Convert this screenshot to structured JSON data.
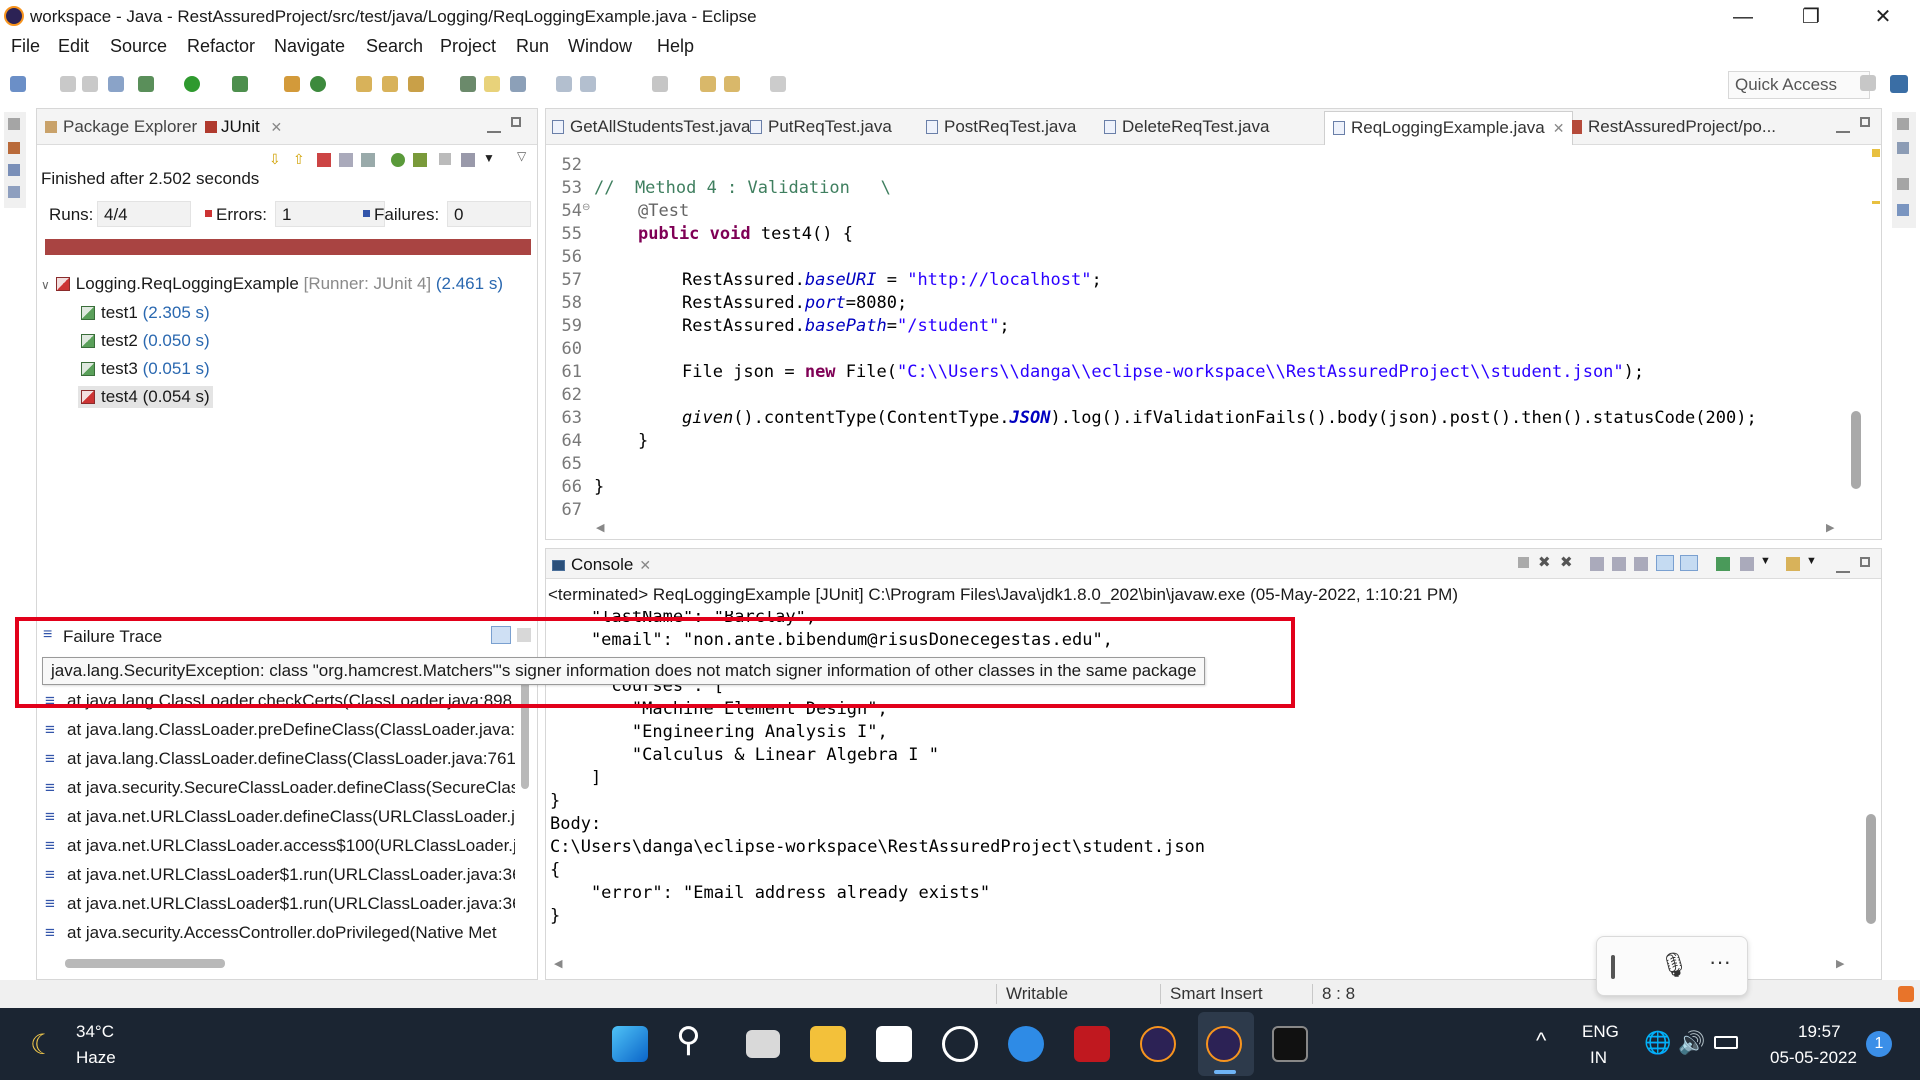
{
  "window": {
    "title": "workspace - Java - RestAssuredProject/src/test/java/Logging/ReqLoggingExample.java - Eclipse"
  },
  "menu": [
    "File",
    "Edit",
    "Source",
    "Refactor",
    "Navigate",
    "Search",
    "Project",
    "Run",
    "Window",
    "Help"
  ],
  "quick_access": "Quick Access",
  "left_view": {
    "tabs": [
      "Package Explorer",
      "JUnit"
    ],
    "status": "Finished after 2.502 seconds",
    "runs_label": "Runs:",
    "runs_value": "4/4",
    "errors_label": "Errors:",
    "errors_value": "1",
    "failures_label": "Failures:",
    "failures_value": "0",
    "suite": {
      "name": "Logging.ReqLoggingExample",
      "runner": "[Runner: JUnit 4]",
      "time": "(2.461 s)"
    },
    "tests": [
      {
        "name": "test1",
        "time": "(2.305 s)"
      },
      {
        "name": "test2",
        "time": "(0.050 s)"
      },
      {
        "name": "test3",
        "time": "(0.051 s)"
      },
      {
        "name": "test4",
        "time": "(0.054 s)"
      }
    ],
    "failure_trace_title": "Failure Trace",
    "trace": [
      "at java.lang.ClassLoader.checkCerts(ClassLoader.java:898",
      "at java.lang.ClassLoader.preDefineClass(ClassLoader.java:",
      "at java.lang.ClassLoader.defineClass(ClassLoader.java:761",
      "at java.security.SecureClassLoader.defineClass(SecureClas",
      "at java.net.URLClassLoader.defineClass(URLClassLoader.ja",
      "at java.net.URLClassLoader.access$100(URLClassLoader.ja",
      "at java.net.URLClassLoader$1.run(URLClassLoader.java:36",
      "at java.net.URLClassLoader$1.run(URLClassLoader.java:36",
      "at java.security.AccessController.doPrivileged(Native Met"
    ]
  },
  "tooltip": "java.lang.SecurityException: class \"org.hamcrest.Matchers\"'s signer information does not match signer information of other classes in the same package",
  "editor": {
    "tabs": [
      "GetAllStudentsTest.java",
      "PutReqTest.java",
      "PostReqTest.java",
      "DeleteReqTest.java",
      "ReqLoggingExample.java",
      "RestAssuredProject/po..."
    ],
    "line_numbers": [
      "52",
      "53",
      "54",
      "55",
      "56",
      "57",
      "58",
      "59",
      "60",
      "61",
      "62",
      "63",
      "64",
      "65",
      "66",
      "67"
    ],
    "code": {
      "l53": "//  Method 4 : Validation   \\",
      "l54": "@Test",
      "l55_kw": "public void",
      "l55_rest": " test4() {",
      "l57_a": "RestAssured.",
      "l57_f": "baseURI",
      "l57_b": " = ",
      "l57_s": "\"http://localhost\"",
      "l57_c": ";",
      "l58_a": "RestAssured.",
      "l58_f": "port",
      "l58_b": "=8080;",
      "l59_a": "RestAssured.",
      "l59_f": "basePath",
      "l59_b": "=",
      "l59_s": "\"/student\"",
      "l59_c": ";",
      "l61_a": "File json = ",
      "l61_kw": "new",
      "l61_b": " File(",
      "l61_s": "\"C:\\\\Users\\\\danga\\\\eclipse-workspace\\\\RestAssuredProject\\\\student.json\"",
      "l61_c": ");",
      "l63_a": "given",
      "l63_b": "().contentType(ContentType.",
      "l63_f": "JSON",
      "l63_c": ").log().ifValidationFails().body(json).post().then().statusCode(200);",
      "l64": "}",
      "l66": "}"
    }
  },
  "console": {
    "tab": "Console",
    "header": "<terminated> ReqLoggingExample [JUnit] C:\\Program Files\\Java\\jdk1.8.0_202\\bin\\javaw.exe (05-May-2022, 1:10:21 PM)",
    "lines": [
      "    \"lastName\": \"Barclay\",",
      "    \"email\": \"non.ante.bibendum@risusDonecegestas.edu\",",
      "     ",
      "     \"courses\": [",
      "        \"Machine Element Design\",",
      "        \"Engineering Analysis I\",",
      "        \"Calculus & Linear Algebra I \"",
      "    ]",
      "}",
      "Body:",
      "C:\\Users\\danga\\eclipse-workspace\\RestAssuredProject\\student.json",
      "{",
      "    \"error\": \"Email address already exists\"",
      "}"
    ]
  },
  "statusbar": {
    "writable": "Writable",
    "insert_mode": "Smart Insert",
    "position": "8 : 8"
  },
  "taskbar": {
    "weather_temp": "34°C",
    "weather_desc": "Haze",
    "lang": "ENG",
    "region": "IN",
    "time": "19:57",
    "date": "05-05-2022",
    "notifications": "1"
  },
  "colors": {
    "error_bar": "#a94442",
    "highlight": "#e2001a",
    "taskbar": "#1b2532"
  }
}
